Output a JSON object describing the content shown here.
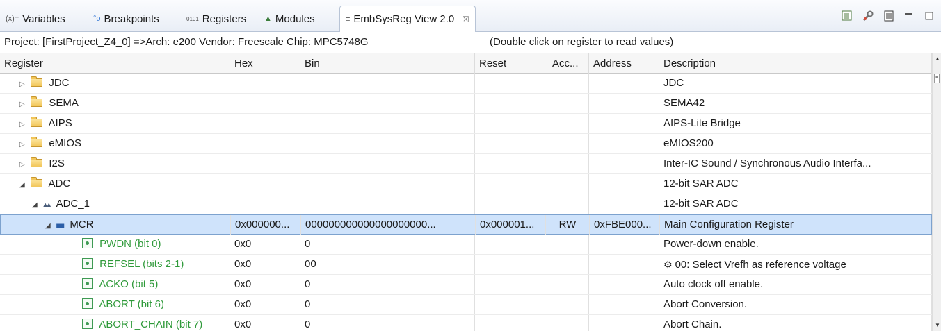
{
  "tabs": [
    {
      "icon": "(x)=",
      "label": "Variables"
    },
    {
      "icon": "°o",
      "label": "Breakpoints"
    },
    {
      "icon": "0101",
      "label": "Registers"
    },
    {
      "icon": "▲",
      "label": "Modules"
    },
    {
      "icon": "≡",
      "label": "EmbSysReg View 2.0",
      "close": "☒"
    }
  ],
  "info": {
    "project": "Project: [FirstProject_Z4_0] =>Arch: e200  Vendor: Freescale  Chip: MPC5748G",
    "hint": "(Double click on register to read values)"
  },
  "columns": [
    "Register",
    "Hex",
    "Bin",
    "Reset",
    "Acc...",
    "Address",
    "Description"
  ],
  "rows": [
    {
      "name": "JDC",
      "hex": "",
      "bin": "",
      "reset": "",
      "acc": "",
      "addr": "",
      "desc": "JDC"
    },
    {
      "name": "SEMA",
      "hex": "",
      "bin": "",
      "reset": "",
      "acc": "",
      "addr": "",
      "desc": "SEMA42"
    },
    {
      "name": "AIPS",
      "hex": "",
      "bin": "",
      "reset": "",
      "acc": "",
      "addr": "",
      "desc": "AIPS-Lite Bridge"
    },
    {
      "name": "eMIOS",
      "hex": "",
      "bin": "",
      "reset": "",
      "acc": "",
      "addr": "",
      "desc": "eMIOS200"
    },
    {
      "name": "I2S",
      "hex": "",
      "bin": "",
      "reset": "",
      "acc": "",
      "addr": "",
      "desc": "Inter-IC Sound / Synchronous Audio Interfa..."
    },
    {
      "name": "ADC",
      "hex": "",
      "bin": "",
      "reset": "",
      "acc": "",
      "addr": "",
      "desc": "12-bit SAR ADC"
    },
    {
      "name": "ADC_1",
      "hex": "",
      "bin": "",
      "reset": "",
      "acc": "",
      "addr": "",
      "desc": "12-bit SAR ADC"
    },
    {
      "name": "MCR",
      "hex": "0x000000...",
      "bin": "000000000000000000000...",
      "reset": "0x000001...",
      "acc": "RW",
      "addr": "0xFBE000...",
      "desc": "Main Configuration Register"
    },
    {
      "name": "PWDN (bit 0)",
      "hex": "0x0",
      "bin": "0",
      "reset": "",
      "acc": "",
      "addr": "",
      "desc": "Power-down enable."
    },
    {
      "name": "REFSEL (bits 2-1)",
      "hex": "0x0",
      "bin": "00",
      "reset": "",
      "acc": "",
      "addr": "",
      "desc": "00: Select Vrefh as reference voltage"
    },
    {
      "name": "ACKO (bit 5)",
      "hex": "0x0",
      "bin": "0",
      "reset": "",
      "acc": "",
      "addr": "",
      "desc": "Auto clock off enable."
    },
    {
      "name": "ABORT (bit 6)",
      "hex": "0x0",
      "bin": "0",
      "reset": "",
      "acc": "",
      "addr": "",
      "desc": "Abort Conversion."
    },
    {
      "name": "ABORT_CHAIN (bit 7)",
      "hex": "0x0",
      "bin": "0",
      "reset": "",
      "acc": "",
      "addr": "",
      "desc": "Abort Chain."
    }
  ],
  "colors": {
    "selected_row": "#cfe3fb",
    "field_text": "#2f9a3a",
    "folder": "#f2c65a"
  },
  "icons": {
    "collapsed": "▷",
    "expanded": "◢",
    "settings_gear": "⚙"
  }
}
